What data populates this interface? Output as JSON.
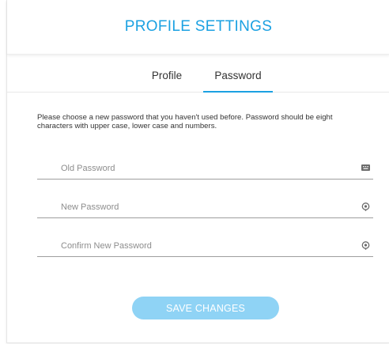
{
  "header": {
    "title": "PROFILE SETTINGS"
  },
  "tabs": [
    {
      "label": "Profile",
      "active": false
    },
    {
      "label": "Password",
      "active": true
    }
  ],
  "intro_text": "Please choose a new password that you haven't used before. Password should be eight characters with upper case, lower case and numbers.",
  "fields": [
    {
      "placeholder": "Old Password",
      "value": "",
      "icon": "keyboard-icon"
    },
    {
      "placeholder": "New Password",
      "value": "",
      "icon": "reveal-password-icon"
    },
    {
      "placeholder": "Confirm New Password",
      "value": "",
      "icon": "reveal-password-icon"
    }
  ],
  "save_button": {
    "label": "SAVE CHANGES"
  },
  "colors": {
    "accent": "#1ba1e2",
    "button_disabled": "#8fd3f5",
    "icon": "#6b6b6b"
  }
}
